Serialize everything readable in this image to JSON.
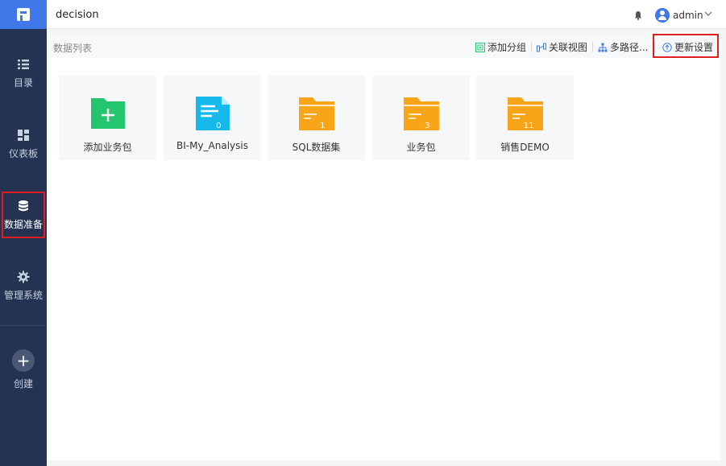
{
  "app": {
    "title": "decision"
  },
  "user": {
    "name": "admin"
  },
  "sidebar": {
    "items": [
      {
        "label": "目录",
        "icon": "list-icon"
      },
      {
        "label": "仪表板",
        "icon": "dashboard-icon"
      },
      {
        "label": "数据准备",
        "icon": "database-icon",
        "active": true
      },
      {
        "label": "管理系统",
        "icon": "gear-icon"
      },
      {
        "label": "创建",
        "icon": "plus-icon"
      }
    ]
  },
  "toolbar": {
    "title": "数据列表",
    "add_group": "添加分组",
    "relation_view": "关联视图",
    "multi_path": "多路径...",
    "update_settings": "更新设置"
  },
  "cards": [
    {
      "name": "添加业务包",
      "icon": "add-icon",
      "color": "#23c66e",
      "count": ""
    },
    {
      "name": "BI-My_Analysis",
      "icon": "file-icon",
      "color": "#16b9ec",
      "count": "0"
    },
    {
      "name": "SQL数据集",
      "icon": "folder-icon",
      "color": "#f9a51a",
      "count": "1"
    },
    {
      "name": "业务包",
      "icon": "folder-icon",
      "color": "#f9a51a",
      "count": "3"
    },
    {
      "name": "销售DEMO",
      "icon": "folder-icon",
      "color": "#f9a51a",
      "count": "11"
    }
  ],
  "colors": {
    "sidebar_bg": "#243352",
    "logo_bg": "#3f78e9",
    "highlight": "#e02020",
    "green": "#23c66e",
    "cyan": "#16b9ec",
    "orange": "#f9a51a"
  }
}
